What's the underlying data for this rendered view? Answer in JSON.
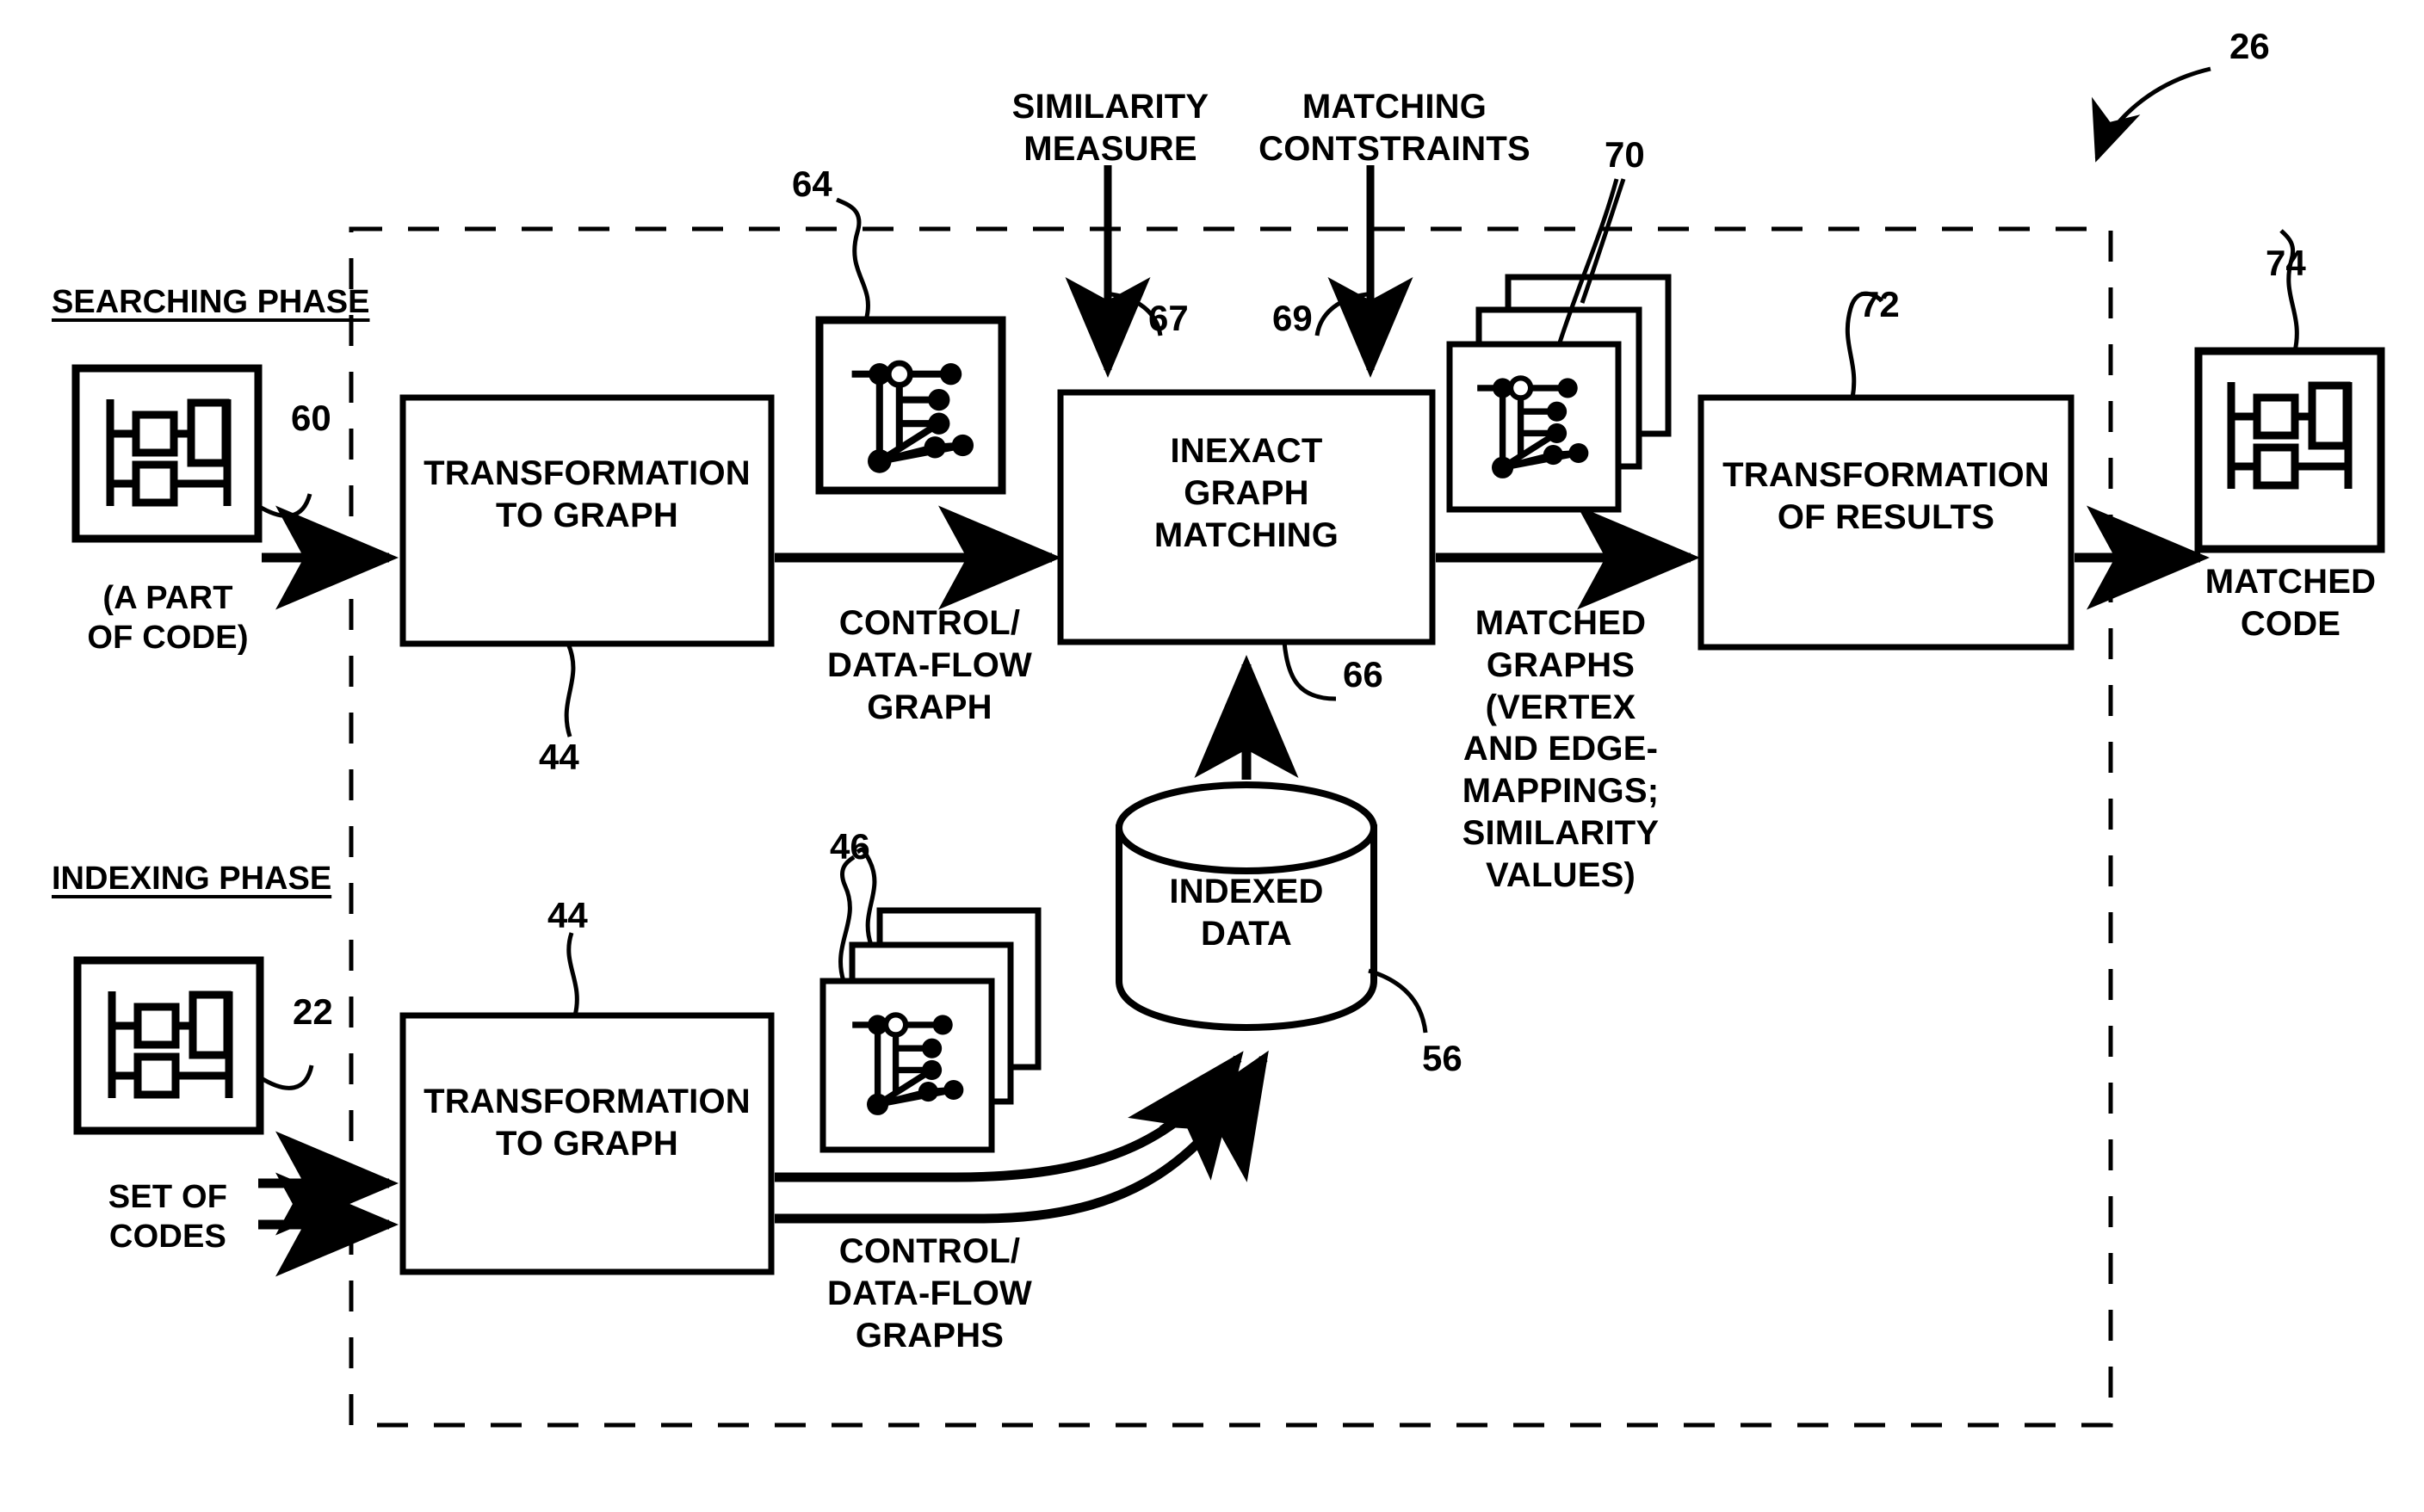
{
  "figure": {
    "kind": "patent-flow-diagram",
    "overall_ref": "26",
    "stroke_color": "#000000",
    "background_color": "#ffffff"
  },
  "phases": {
    "searching_label": "SEARCHING PHASE",
    "indexing_label": "INDEXING PHASE"
  },
  "inputs": {
    "search_code_icon_ref": "60",
    "search_code_caption": "(A PART\nOF CODE)",
    "index_code_icon_ref": "22",
    "index_code_caption": "SET OF\nCODES"
  },
  "boxes": {
    "transform_search": {
      "label": "TRANSFORMATION\nTO GRAPH",
      "ref": "44"
    },
    "transform_index": {
      "label": "TRANSFORMATION\nTO GRAPH",
      "ref": "44"
    },
    "matching": {
      "label": "INEXACT\nGRAPH\nMATCHING",
      "ref": "66"
    },
    "results": {
      "label": "TRANSFORMATION\nOF RESULTS",
      "ref": "72"
    }
  },
  "datastore": {
    "label": "INDEXED\nDATA",
    "ref": "56"
  },
  "graph_icons": {
    "single_graph_ref": "64",
    "matched_graphs_stack_ref": "70",
    "indexed_graphs_stack_ref": "46"
  },
  "outputs": {
    "matched_code_icon_ref": "74",
    "matched_code_caption": "MATCHED\nCODE"
  },
  "edge_labels": {
    "control_dataflow_graph": "CONTROL/\nDATA-FLOW\nGRAPH",
    "control_dataflow_graphs": "CONTROL/\nDATA-FLOW\nGRAPHS",
    "matched_graphs": "MATCHED\nGRAPHS\n(VERTEX\nAND EDGE-\nMAPPINGS;\nSIMILARITY\nVALUES)"
  },
  "external_inputs": {
    "similarity_measure": {
      "label": "SIMILARITY\nMEASURE",
      "ref": "67"
    },
    "matching_constraints": {
      "label": "MATCHING\nCONTSTRAINTS",
      "ref": "69"
    }
  }
}
